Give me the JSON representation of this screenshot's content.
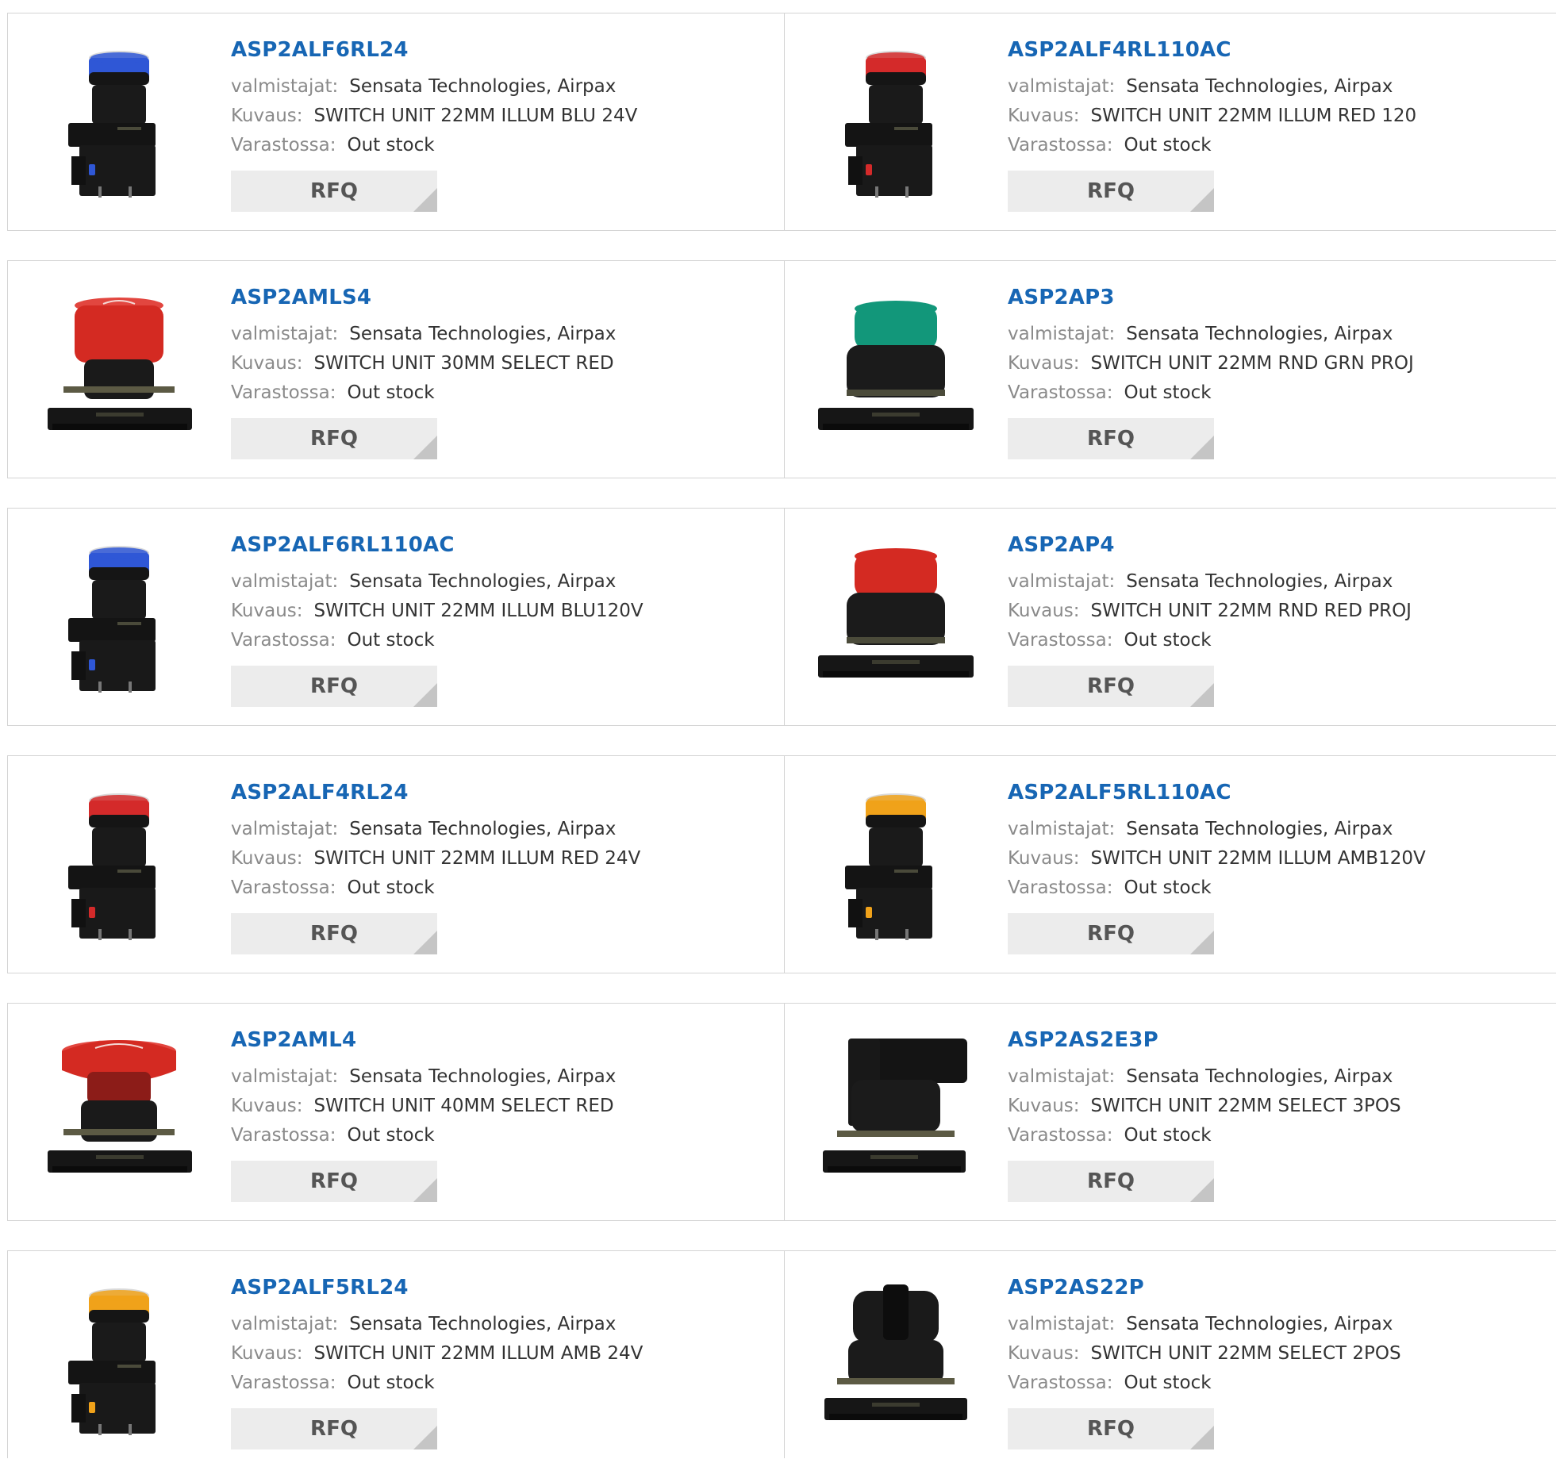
{
  "labels": {
    "manufacturer": "valmistajat:",
    "description": "Kuvaus:",
    "stock": "Varastossa:",
    "rfq": "RFQ"
  },
  "products": [
    {
      "part": "ASP2ALF6RL24",
      "manufacturer": "Sensata Technologies, Airpax",
      "description": "SWITCH UNIT 22MM ILLUM BLU 24V",
      "stock": "Out stock",
      "image": {
        "style": "illuminated",
        "cap_color": "#2f57d6"
      }
    },
    {
      "part": "ASP2ALF4RL110AC",
      "manufacturer": "Sensata Technologies, Airpax",
      "description": "SWITCH UNIT 22MM ILLUM RED 120",
      "stock": "Out stock",
      "image": {
        "style": "illuminated",
        "cap_color": "#d42a2a"
      }
    },
    {
      "part": "ASP2AMLS4",
      "manufacturer": "Sensata Technologies, Airpax",
      "description": "SWITCH UNIT 30MM SELECT RED",
      "stock": "Out stock",
      "image": {
        "style": "mushroom-small",
        "cap_color": "#d42a22"
      }
    },
    {
      "part": "ASP2AP3",
      "manufacturer": "Sensata Technologies, Airpax",
      "description": "SWITCH UNIT 22MM RND GRN PROJ",
      "stock": "Out stock",
      "image": {
        "style": "projecting",
        "cap_color": "#12977a"
      }
    },
    {
      "part": "ASP2ALF6RL110AC",
      "manufacturer": "Sensata Technologies, Airpax",
      "description": "SWITCH UNIT 22MM ILLUM BLU120V",
      "stock": "Out stock",
      "image": {
        "style": "illuminated",
        "cap_color": "#2f57d6"
      }
    },
    {
      "part": "ASP2AP4",
      "manufacturer": "Sensata Technologies, Airpax",
      "description": "SWITCH UNIT 22MM RND RED PROJ",
      "stock": "Out stock",
      "image": {
        "style": "projecting",
        "cap_color": "#d42a22"
      }
    },
    {
      "part": "ASP2ALF4RL24",
      "manufacturer": "Sensata Technologies, Airpax",
      "description": "SWITCH UNIT 22MM ILLUM RED 24V",
      "stock": "Out stock",
      "image": {
        "style": "illuminated",
        "cap_color": "#d42a2a"
      }
    },
    {
      "part": "ASP2ALF5RL110AC",
      "manufacturer": "Sensata Technologies, Airpax",
      "description": "SWITCH UNIT 22MM ILLUM AMB120V",
      "stock": "Out stock",
      "image": {
        "style": "illuminated",
        "cap_color": "#f0a21a"
      }
    },
    {
      "part": "ASP2AML4",
      "manufacturer": "Sensata Technologies, Airpax",
      "description": "SWITCH UNIT 40MM SELECT RED",
      "stock": "Out stock",
      "image": {
        "style": "mushroom-large",
        "cap_color": "#d42a22"
      }
    },
    {
      "part": "ASP2AS2E3P",
      "manufacturer": "Sensata Technologies, Airpax",
      "description": "SWITCH UNIT 22MM SELECT 3POS",
      "stock": "Out stock",
      "image": {
        "style": "selector-lever",
        "cap_color": "#111111"
      }
    },
    {
      "part": "ASP2ALF5RL24",
      "manufacturer": "Sensata Technologies, Airpax",
      "description": "SWITCH UNIT 22MM ILLUM AMB 24V",
      "stock": "Out stock",
      "image": {
        "style": "illuminated",
        "cap_color": "#f0a21a"
      }
    },
    {
      "part": "ASP2AS22P",
      "manufacturer": "Sensata Technologies, Airpax",
      "description": "SWITCH UNIT 22MM SELECT 2POS",
      "stock": "Out stock",
      "image": {
        "style": "selector-knob",
        "cap_color": "#111111"
      }
    }
  ]
}
